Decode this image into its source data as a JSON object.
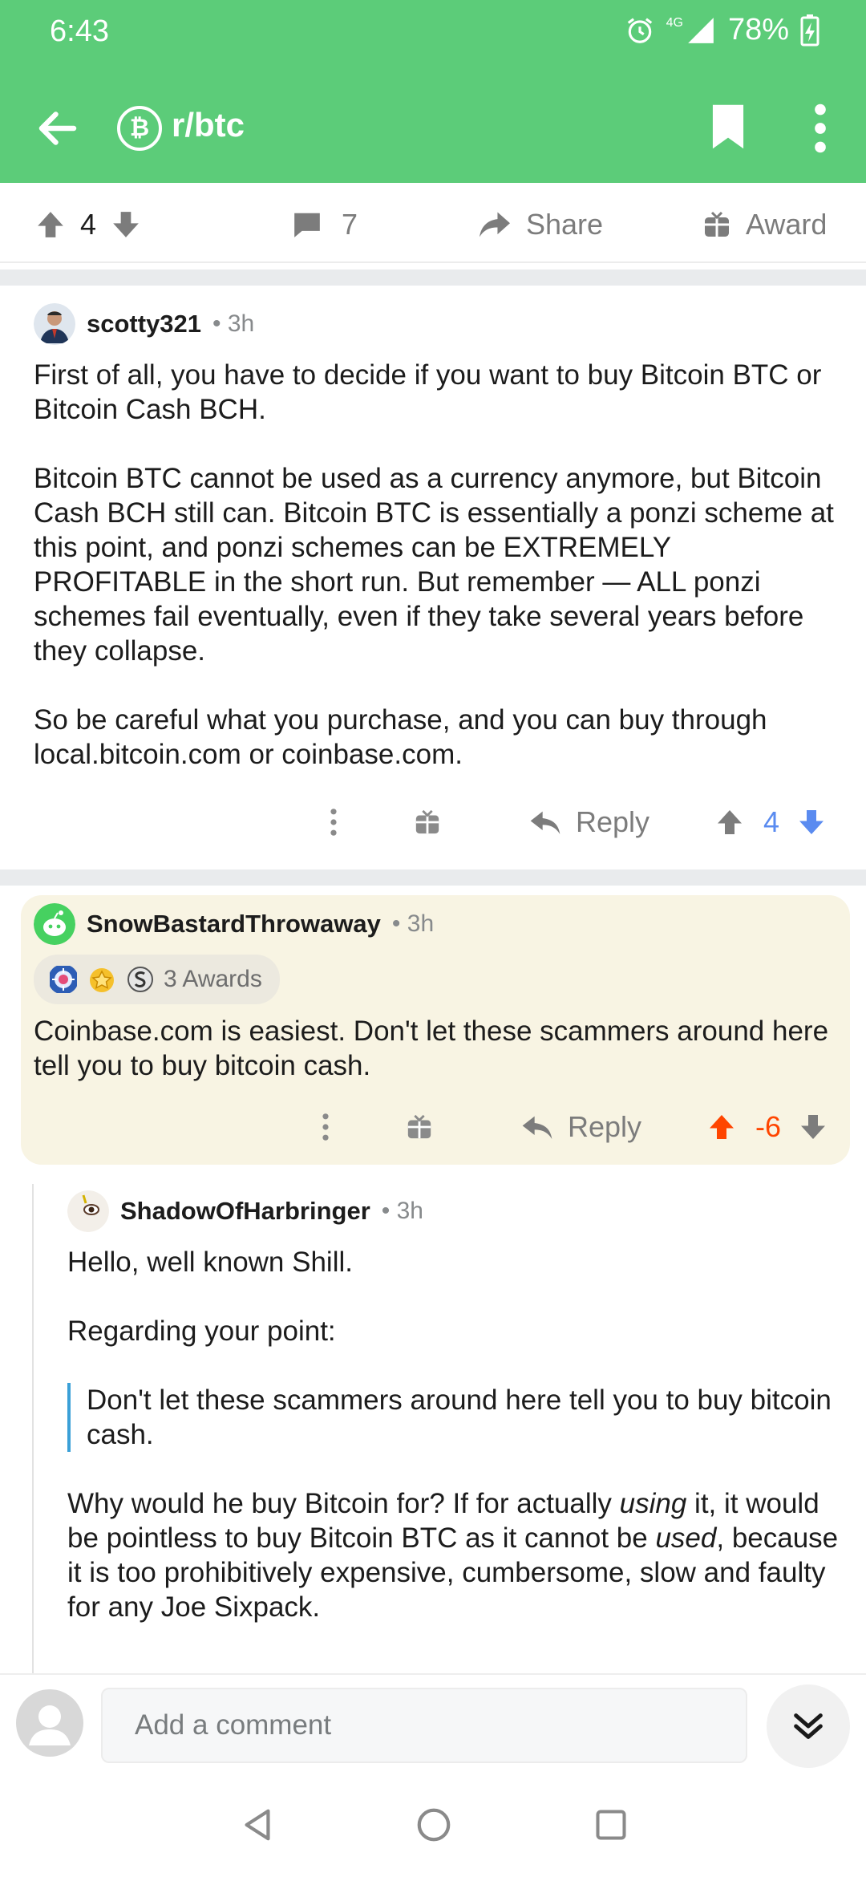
{
  "status": {
    "time": "6:43",
    "network": "4G",
    "battery": "78%"
  },
  "toolbar": {
    "subreddit": "r/btc",
    "sub_icon": "bitcoin-icon"
  },
  "post_actions": {
    "score": "4",
    "comments": "7",
    "share_label": "Share",
    "award_label": "Award"
  },
  "comments": [
    {
      "user": "scotty321",
      "time": "3h",
      "paragraphs": [
        "First of all, you have to decide if you want to buy Bitcoin BTC or Bitcoin Cash BCH.",
        "Bitcoin BTC cannot be used as a currency anymore, but Bitcoin Cash BCH still can. Bitcoin BTC is essentially a ponzi scheme at this point, and ponzi schemes can be EXTREMELY PROFITABLE in the short run. But remember — ALL ponzi schemes fail eventually, even if they take several years before they collapse.",
        "So be careful what you purchase, and you can buy through local.bitcoin.com or coinbase.com."
      ],
      "reply_label": "Reply",
      "score": "4",
      "vote_color": "#5a8bf0"
    },
    {
      "user": "SnowBastardThrowaway",
      "time": "3h",
      "awards_label": "3 Awards",
      "paragraphs": [
        "Coinbase.com is easiest. Don't let these scammers around here tell you to buy bitcoin cash."
      ],
      "reply_label": "Reply",
      "score": "-6",
      "vote_color": "#ff4500",
      "highlight_color": "#f8f4e3"
    },
    {
      "user": "ShadowOfHarbringer",
      "time": "3h",
      "p1": "Hello, well known Shill.",
      "p2": "Regarding your point:",
      "quote": "Don't let these scammers around here tell you to buy bitcoin cash.",
      "p3_a": "Why would he buy Bitcoin for? If for actually ",
      "p3_em1": "using",
      "p3_b": " it, it would be pointless to buy Bitcoin BTC as it cannot be ",
      "p3_em2": "used",
      "p3_c": ", because it is too prohibitively expensive, cumbersome, slow and faulty for any Joe Sixpack."
    }
  ],
  "composer": {
    "placeholder": "Add a comment"
  },
  "colors": {
    "header": "#5ccc79",
    "upvote": "#ff4500",
    "downvote": "#5a8bf0"
  }
}
